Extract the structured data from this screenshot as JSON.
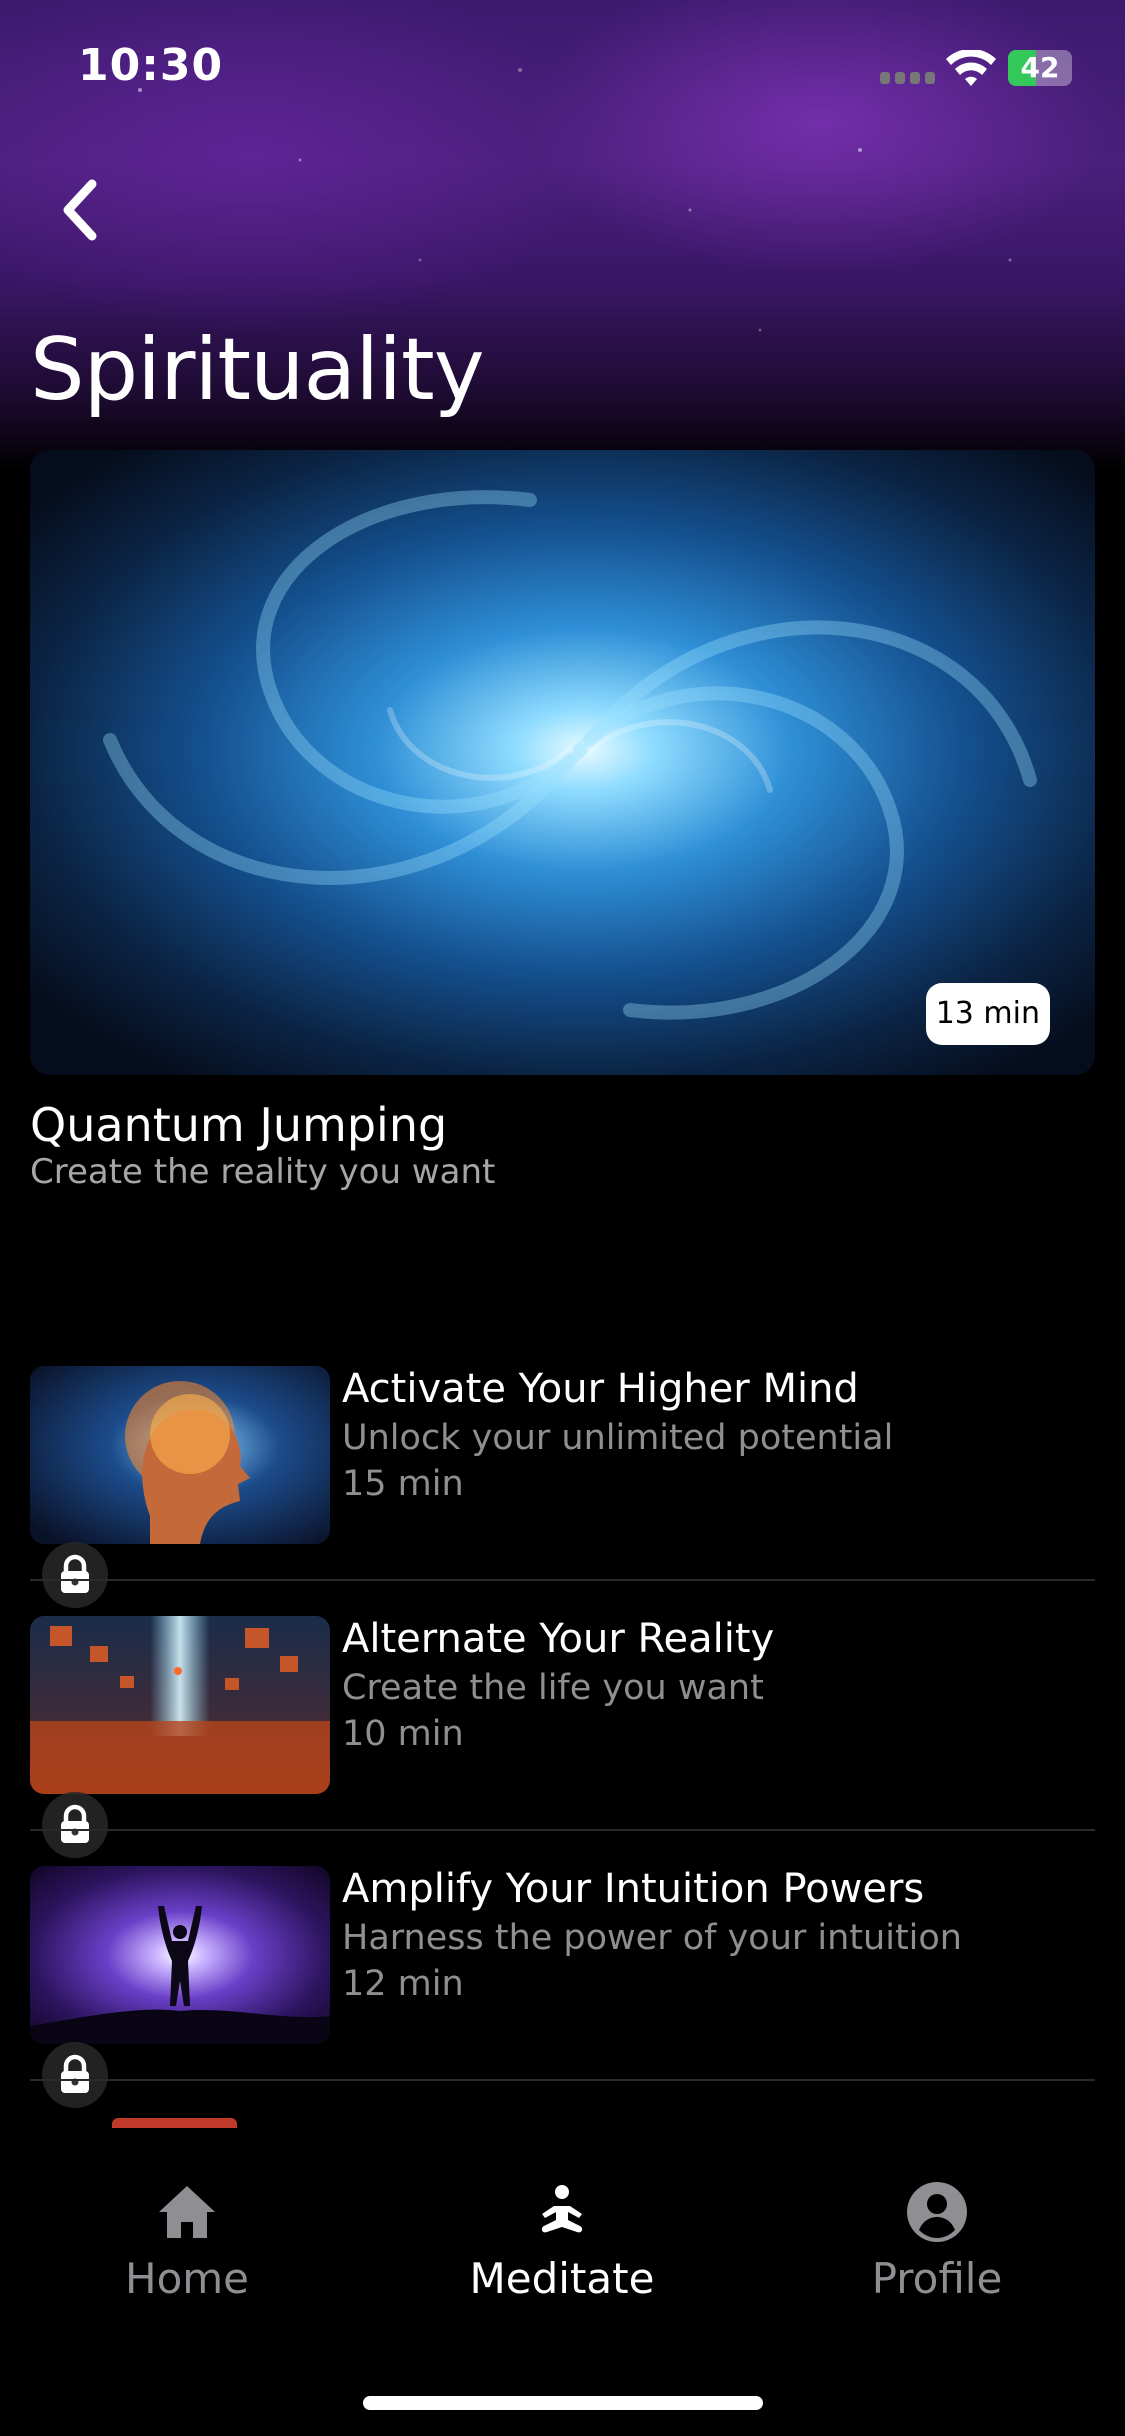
{
  "status_bar": {
    "time": "10:30",
    "battery_level": "42",
    "battery_color": "#34c759"
  },
  "header": {
    "back_icon": "chevron-left-icon",
    "title": "Spirituality"
  },
  "featured": {
    "title": "Quantum Jumping",
    "subtitle": "Create the reality you want",
    "duration": "13 min",
    "image": "blue-swirl-galaxy"
  },
  "items": [
    {
      "title": "Activate Your Higher Mind",
      "subtitle": "Unlock your unlimited potential",
      "duration": "15 min",
      "locked": true,
      "image": "glowing-head"
    },
    {
      "title": "Alternate Your Reality",
      "subtitle": "Create the life you want",
      "duration": "10 min",
      "locked": true,
      "image": "floating-cubes"
    },
    {
      "title": "Amplify Your Intuition Powers",
      "subtitle": "Harness the power of your intuition",
      "duration": "12 min",
      "locked": true,
      "image": "cosmic-figure"
    }
  ],
  "tab_bar": {
    "tabs": [
      {
        "label": "Home",
        "icon": "home-icon",
        "active": false
      },
      {
        "label": "Meditate",
        "icon": "meditate-icon",
        "active": true
      },
      {
        "label": "Profile",
        "icon": "profile-icon",
        "active": false
      }
    ]
  },
  "colors": {
    "background": "#000000",
    "active_tab": "#ffffff",
    "inactive_tab": "#8e8e93",
    "secondary_text": "#8f8f8f"
  }
}
